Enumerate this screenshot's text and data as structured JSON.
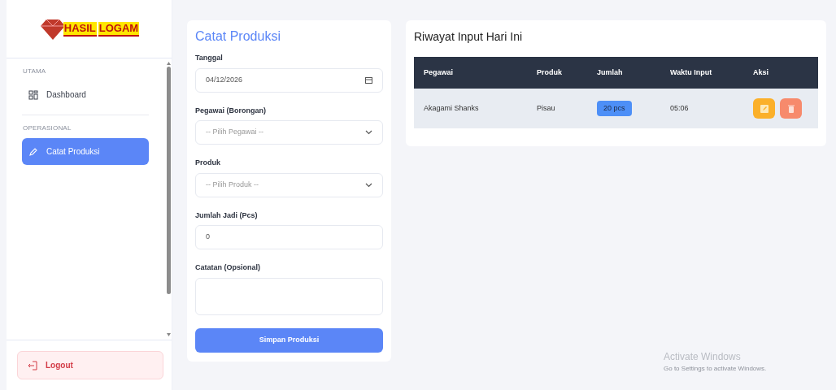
{
  "sidebar": {
    "logo": {
      "word_1": "HASIL",
      "word_2": "LOGAM"
    },
    "sections": [
      {
        "label": "UTAMA",
        "items": [
          {
            "label": "Dashboard",
            "selected": false
          }
        ]
      },
      {
        "label": "OPERASIONAL",
        "items": [
          {
            "label": "Catat Produksi",
            "selected": true
          }
        ]
      }
    ],
    "logout": "Logout"
  },
  "form": {
    "title": "Catat Produksi",
    "fields": [
      {
        "kind": "date",
        "label": "Tanggal",
        "value": "04/12/2026"
      },
      {
        "kind": "select",
        "label": "Pegawai (Borongan)",
        "placeholder": "-- Pilih Pegawai --"
      },
      {
        "kind": "select",
        "label": "Produk",
        "placeholder": "-- Pilih Produk --"
      },
      {
        "kind": "number",
        "label": "Jumlah Jadi (Pcs)",
        "value": "0"
      },
      {
        "kind": "textarea",
        "label": "Catatan (Opsional)"
      }
    ],
    "submit": "Simpan Produksi"
  },
  "history": {
    "title": "Riwayat Input Hari Ini",
    "columns": [
      "Pegawai",
      "Produk",
      "Jumlah",
      "Waktu Input",
      "Aksi"
    ],
    "rows": [
      {
        "pegawai": "Akagami Shanks",
        "produk": "Pisau",
        "jumlah": "20 pcs",
        "waktu": "05:06"
      }
    ]
  },
  "os_overlay": {
    "title": "Activate Windows",
    "subtitle": "Go to Settings to activate Windows."
  }
}
